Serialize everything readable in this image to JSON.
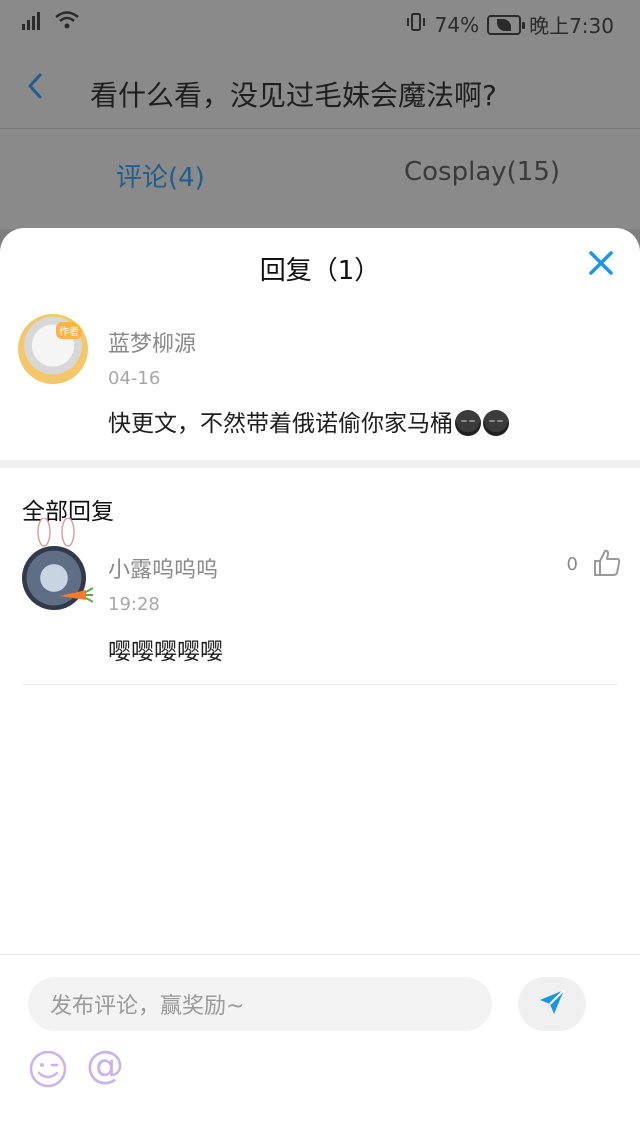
{
  "status_bar": {
    "battery_percent": "74%",
    "time": "晚上7:30"
  },
  "background_page": {
    "title": "看什么看，没见过毛妹会魔法啊?",
    "tabs": [
      {
        "label": "评论(4)"
      },
      {
        "label": "Cosplay(15)"
      }
    ]
  },
  "modal": {
    "title": "回复（1）",
    "original_comment": {
      "avatar_badge": "作者",
      "username": "蓝梦柳源",
      "date": "04-16",
      "text": "快更文，不然带着俄诺偷你家马桶"
    },
    "replies_section_title": "全部回复",
    "replies": [
      {
        "username": "小露呜呜呜",
        "time": "19:28",
        "text": "嘤嘤嘤嘤嘤",
        "likes": "0"
      }
    ],
    "input": {
      "placeholder": "发布评论，赢奖励~"
    }
  },
  "colors": {
    "accent": "#1a96e6",
    "emoji_accent": "#c9b2ee"
  }
}
